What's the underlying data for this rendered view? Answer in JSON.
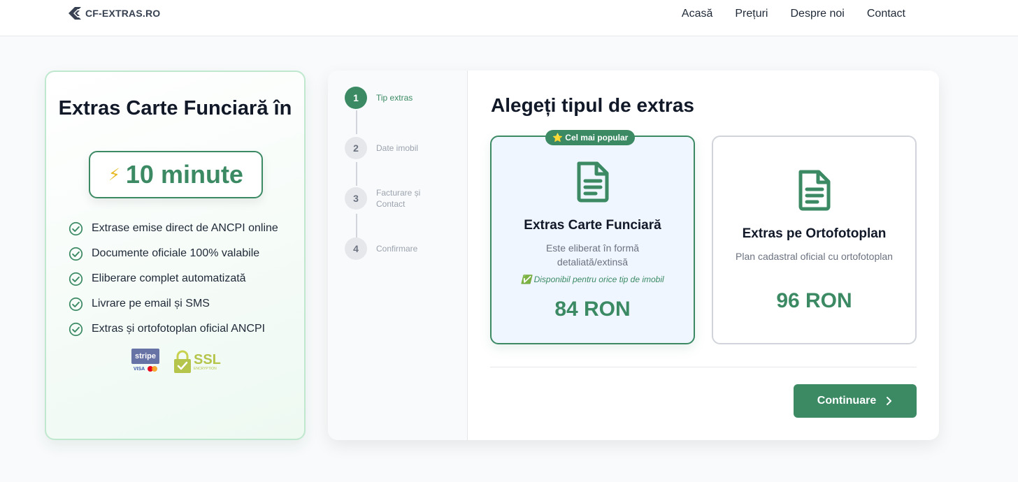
{
  "header": {
    "logo_text": "CF-EXTRAS.RO",
    "nav": [
      "Acasă",
      "Prețuri",
      "Despre noi",
      "Contact"
    ]
  },
  "promo": {
    "title": "Extras Carte Funciară în",
    "highlight": "10 minute",
    "features": [
      "Extrase emise direct de ANCPI online",
      "Documente oficiale 100% valabile",
      "Eliberare complet automatizată",
      "Livrare pe email și SMS",
      "Extras și ortofotoplan oficial ANCPI"
    ],
    "badges": {
      "stripe": "stripe",
      "visa": "VISA",
      "ssl": "SSL",
      "ssl_sub": "ENCRYPTION"
    }
  },
  "steps": [
    {
      "number": "1",
      "label": "Tip extras"
    },
    {
      "number": "2",
      "label": "Date imobil"
    },
    {
      "number": "3",
      "label": "Facturare și Contact"
    },
    {
      "number": "4",
      "label": "Confirmare"
    }
  ],
  "main": {
    "title": "Alegeți tipul de extras",
    "options": [
      {
        "badge": "⭐ Cel mai popular",
        "name": "Extras Carte Funciară",
        "description": "Este eliberat în formă detaliată/extinsă",
        "availability": "✅ Disponibil pentru orice tip de imobil",
        "price": "84 RON"
      },
      {
        "name": "Extras pe Ortofotoplan",
        "description": "Plan cadastral oficial cu ortofotoplan",
        "price": "96 RON"
      }
    ],
    "continue_label": "Continuare"
  },
  "colors": {
    "accent": "#3b8a64",
    "selected_bg": "#f0f6ff",
    "promo_border": "#bfe8cf"
  }
}
